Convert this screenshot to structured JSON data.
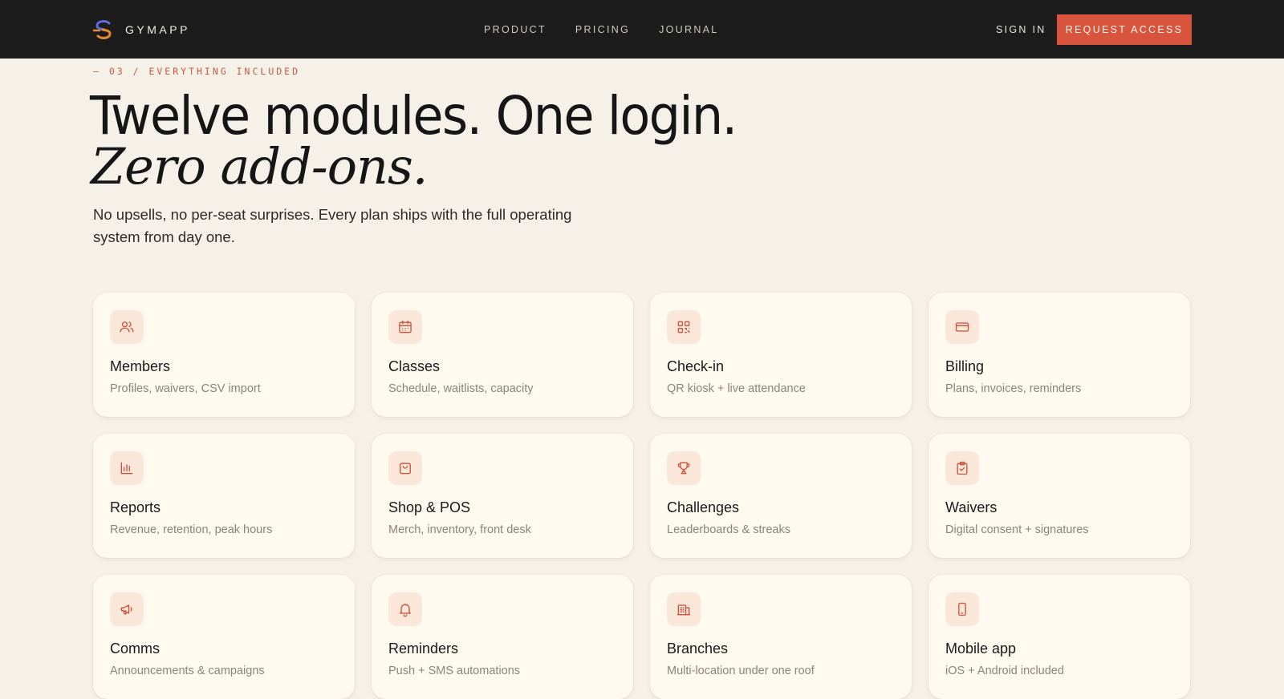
{
  "brand": {
    "name": "GYMAPP"
  },
  "nav": {
    "items": [
      "PRODUCT",
      "PRICING",
      "JOURNAL"
    ]
  },
  "header": {
    "sign_in": "SIGN IN",
    "cta": "REQUEST ACCESS"
  },
  "hero": {
    "eyebrow": "— 03 / EVERYTHING INCLUDED",
    "title_line1": "Twelve modules. One login.",
    "title_line2": "Zero add-ons.",
    "lede": "No upsells, no per-seat surprises. Every plan ships with the full operating system from day one."
  },
  "colors": {
    "accent": "#d9543d",
    "topbar": "#1c1c1c",
    "background": "#f5f1e9",
    "card": "#fefaf0",
    "icon_tile": "#fbe6da"
  },
  "modules": [
    {
      "title": "Members",
      "desc": "Profiles, waivers, CSV import",
      "icon": "users-icon"
    },
    {
      "title": "Classes",
      "desc": "Schedule, waitlists, capacity",
      "icon": "calendar-icon"
    },
    {
      "title": "Check-in",
      "desc": "QR kiosk + live attendance",
      "icon": "qr-code-icon"
    },
    {
      "title": "Billing",
      "desc": "Plans, invoices, reminders",
      "icon": "credit-card-icon"
    },
    {
      "title": "Reports",
      "desc": "Revenue, retention, peak hours",
      "icon": "bar-chart-icon"
    },
    {
      "title": "Shop & POS",
      "desc": "Merch, inventory, front desk",
      "icon": "shopping-bag-icon"
    },
    {
      "title": "Challenges",
      "desc": "Leaderboards & streaks",
      "icon": "trophy-icon"
    },
    {
      "title": "Waivers",
      "desc": "Digital consent + signatures",
      "icon": "clipboard-check-icon"
    },
    {
      "title": "Comms",
      "desc": "Announcements & campaigns",
      "icon": "megaphone-icon"
    },
    {
      "title": "Reminders",
      "desc": "Push + SMS automations",
      "icon": "bell-icon"
    },
    {
      "title": "Branches",
      "desc": "Multi-location under one roof",
      "icon": "building-icon"
    },
    {
      "title": "Mobile app",
      "desc": "iOS + Android included",
      "icon": "smartphone-icon"
    }
  ]
}
